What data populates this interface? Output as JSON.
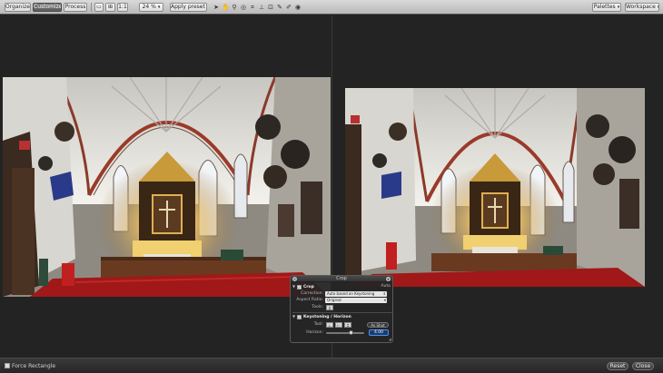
{
  "toolbar": {
    "modes": [
      "Organize",
      "Customize",
      "Process"
    ],
    "active_mode": "Customize",
    "view_fit": "1:1",
    "zoom": "24 %",
    "apply_preset": "Apply preset",
    "palettes": "Palettes",
    "workspace": "Workspace",
    "tools": [
      "pointer-tool",
      "hand-tool",
      "zoom-tool",
      "loupe-tool",
      "crop-tool",
      "straighten-tool",
      "keystone-tool",
      "spot-removal-tool",
      "white-balance-tool",
      "color-picker-tool"
    ]
  },
  "crop_hud": {
    "title": "Crop",
    "crop_section": "Crop",
    "crop_value": "Auto",
    "correction_label": "Correction:",
    "correction_value": "Auto based on Keystoning",
    "aspect_label": "Aspect Ratio:",
    "aspect_value": "Original",
    "tools_label": "Tools:",
    "keystone_section": "Keystoning / Horizon",
    "tool_label": "Tool:",
    "as_shot_label": "As Shot",
    "horizon_label": "Horizon:",
    "horizon_value": "4.00"
  },
  "bottom": {
    "force_rectangle": "Force Rectangle",
    "reset": "Reset",
    "close": "Close"
  }
}
